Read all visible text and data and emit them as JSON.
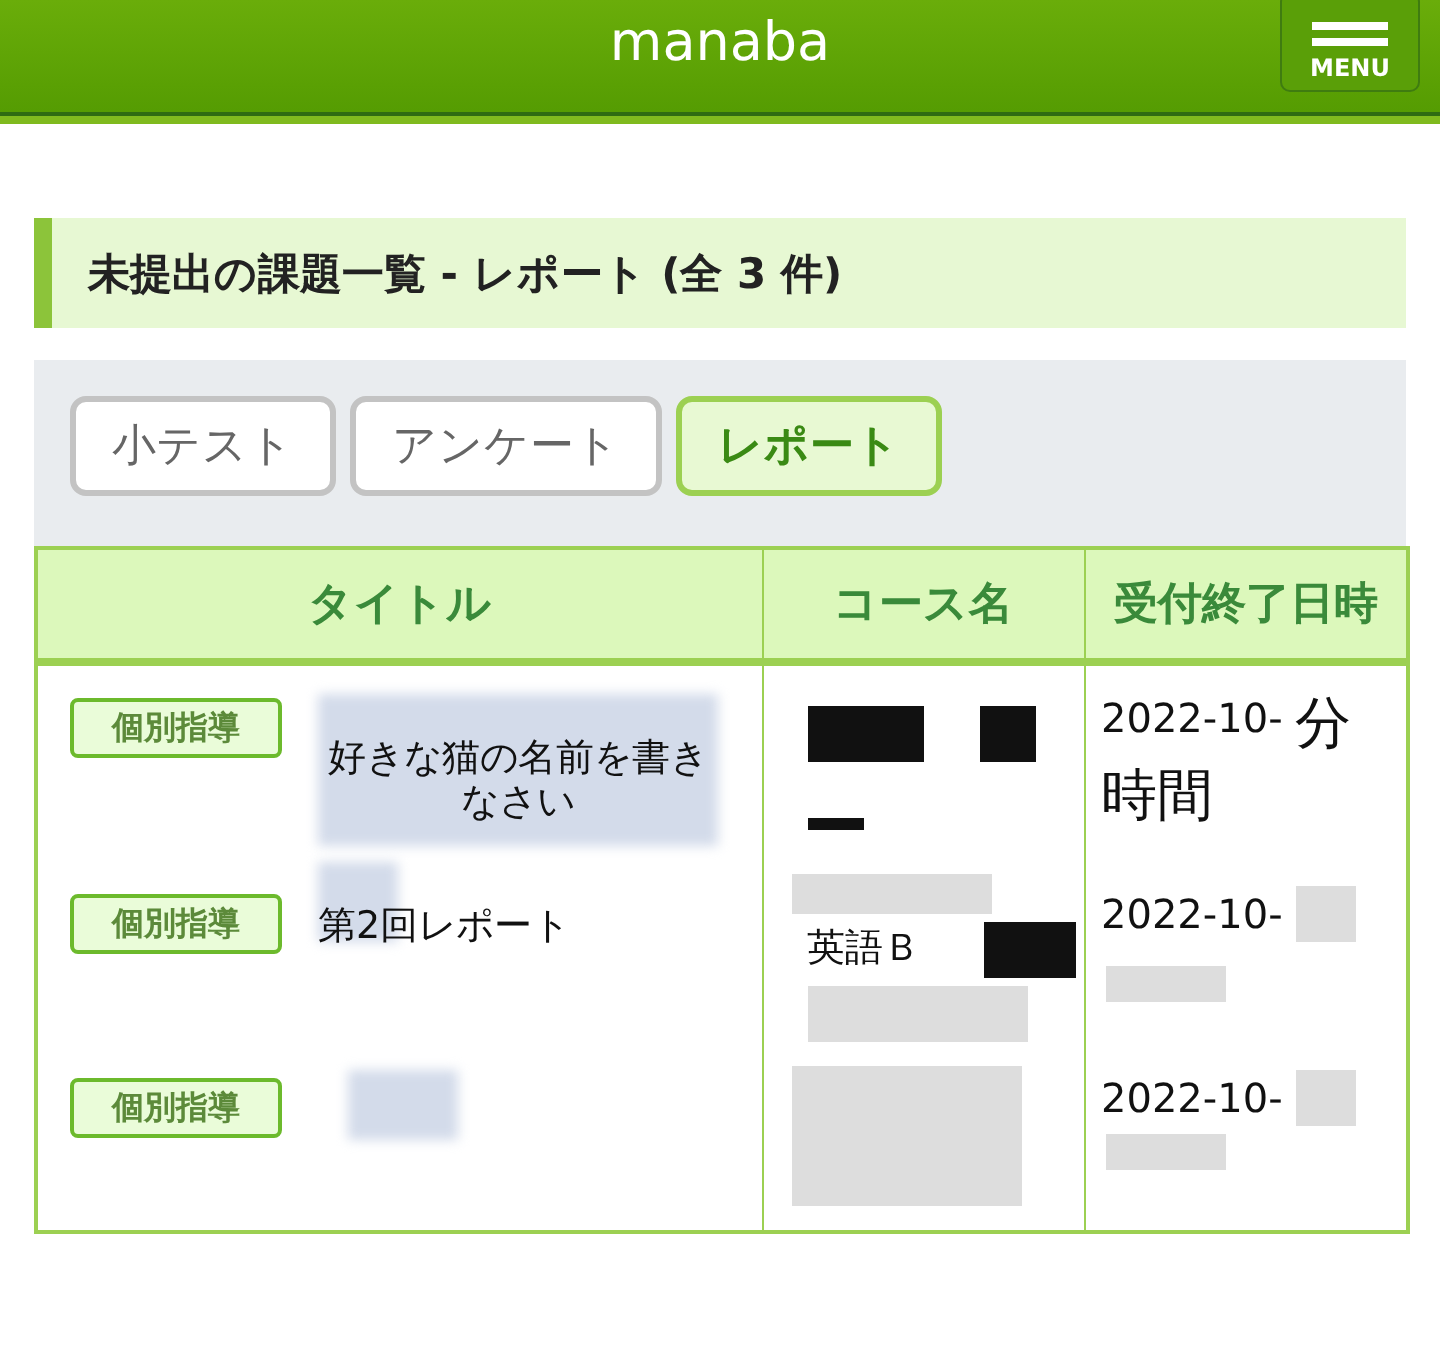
{
  "header": {
    "title": "manaba",
    "menu_label": "MENU"
  },
  "section_title": "未提出の課題一覧 - レポート (全 3 件)",
  "tabs": [
    {
      "label": "小テスト",
      "selected": false
    },
    {
      "label": "アンケート",
      "selected": false
    },
    {
      "label": "レポート",
      "selected": true
    }
  ],
  "table": {
    "columns": [
      "タイトル",
      "コース名",
      "受付終了日時"
    ],
    "rows": [
      {
        "badge": "個別指導",
        "title": "好きな猫の名前を書きなさい",
        "deadline": "2022-10-",
        "handwritten": [
          "分",
          "時間"
        ]
      },
      {
        "badge": "個別指導",
        "title": "第2回レポート",
        "course": "英語Ｂ",
        "deadline": "2022-10-"
      },
      {
        "badge": "個別指導",
        "deadline": "2022-10-"
      }
    ]
  }
}
